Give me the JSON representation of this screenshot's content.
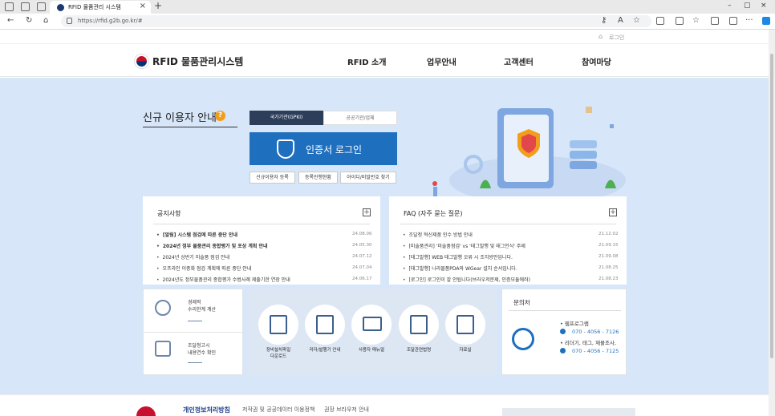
{
  "browser": {
    "tab_title": "RFID 물품관리 시스템",
    "url": "https://rfid.g2b.go.kr/#"
  },
  "util": {
    "login_label": "로그인"
  },
  "header": {
    "logo_text": "RFID 물품관리시스템",
    "menu": [
      "RFID 소개",
      "업무안내",
      "고객센터",
      "참여마당"
    ]
  },
  "login": {
    "title": "신규 이용자 안내",
    "help_icon": "?",
    "tabs": [
      "국가기관(GPKI)",
      "공공기관/업체"
    ],
    "cert_button": "인증서 로그인",
    "sub_buttons": [
      "신규이용자 등록",
      "등록진행현황",
      "아이디/비밀번호 찾기"
    ]
  },
  "notice": {
    "title": "공지사항",
    "items": [
      {
        "text": "[알림] 시스템 점검에 따른 중단 안내",
        "date": "24.08.06",
        "bold": true
      },
      {
        "text": "2024년 정부 물품관리 종합평가 및 포상 계획 안내",
        "date": "24.05.30",
        "bold": true
      },
      {
        "text": "2024년 상반기 미술품 점검 안내",
        "date": "24.07.12",
        "bold": false
      },
      {
        "text": "오프라인 이중화 점검 계획에 따른 중단 안내",
        "date": "24.07.04",
        "bold": false
      },
      {
        "text": "2024년도 정부물품관리 종합평가 수범사례 제출기한 연장 안내",
        "date": "24.06.17",
        "bold": false
      }
    ]
  },
  "faq": {
    "title": "FAQ (자주 묻는 질문)",
    "items": [
      {
        "text": "조달청 혁신제품 인수 방법 안내",
        "date": "21.12.02"
      },
      {
        "text": "[미술품관리] '미술품점검' vs '태그발행 및 태그인식' 주제",
        "date": "21.09.15"
      },
      {
        "text": "[태그발행] WEB 태그발행 오류 시 조치방안입니다.",
        "date": "21.09.08"
      },
      {
        "text": "[태그발행] 나라물품PDA와 WGear 설치 순서입니다.",
        "date": "21.08.25"
      },
      {
        "text": "[로그인] 로그인이 잘 안됩니다(브라우저문제, 인증모듈에러)",
        "date": "21.08.23"
      }
    ]
  },
  "quick": {
    "items": [
      {
        "label_1": "경제적",
        "label_2": "수리한계 계산"
      },
      {
        "label_1": "조달청고시",
        "label_2": "내용연수 확인"
      }
    ]
  },
  "shortcuts": {
    "items": [
      {
        "label_1": "장비설치파일",
        "label_2": "다운로드"
      },
      {
        "label_1": "리더/발행기 안내",
        "label_2": ""
      },
      {
        "label_1": "사용자 매뉴얼",
        "label_2": ""
      },
      {
        "label_1": "조달관련법령",
        "label_2": ""
      },
      {
        "label_1": "자료실",
        "label_2": ""
      }
    ]
  },
  "contact": {
    "title": "문의처",
    "line1": "• 웹프로그램",
    "phone1": "070 - 4056 - 7126",
    "line2": "• 리더기, 태그, 재물조사,",
    "phone2": "070 - 4056 - 7125"
  },
  "footer": {
    "links": [
      "개인정보처리방침",
      "저작권 및 공공데이터 이용정책",
      "권장 브라우저 안내"
    ]
  },
  "colors": {
    "accent": "#1f6fbf",
    "hero_bg": "#d7e6f8",
    "dark_tab": "#2c3e5a",
    "help_orange": "#f29e1b"
  }
}
